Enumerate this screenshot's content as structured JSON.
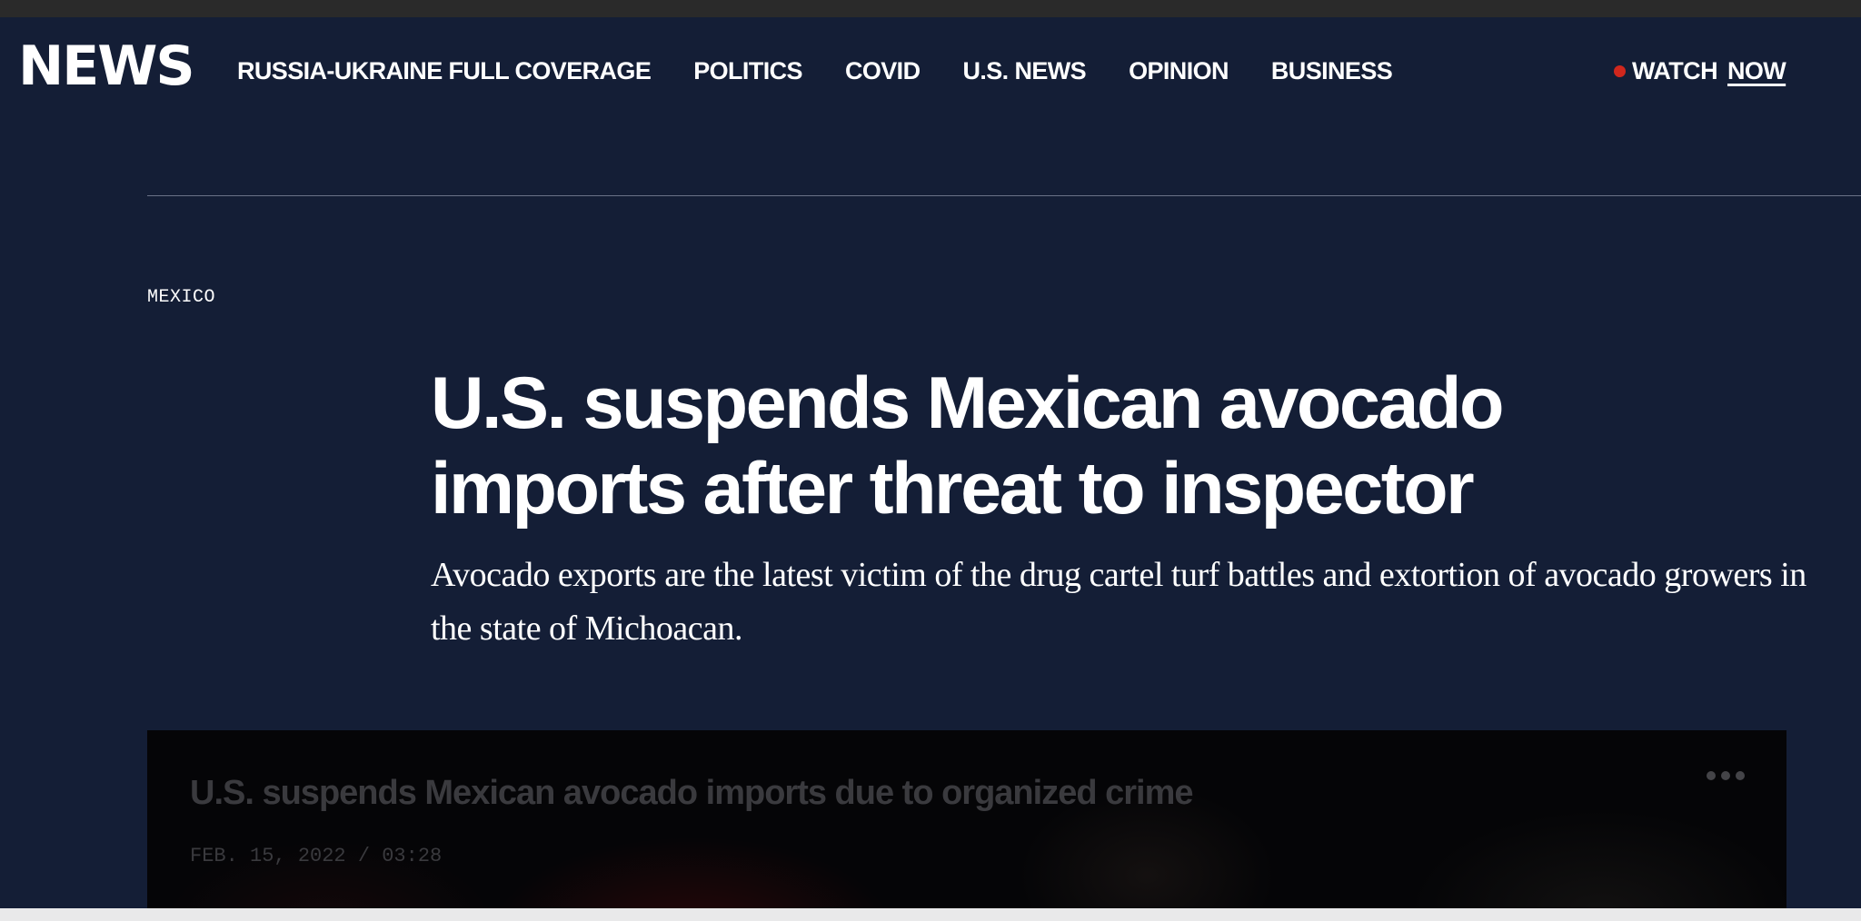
{
  "header": {
    "logo": "NEWS",
    "nav": [
      {
        "label": "RUSSIA-UKRAINE FULL COVERAGE"
      },
      {
        "label": "POLITICS"
      },
      {
        "label": "COVID"
      },
      {
        "label": "U.S. NEWS"
      },
      {
        "label": "OPINION"
      },
      {
        "label": "BUSINESS"
      }
    ],
    "watch": {
      "label": "WATCH",
      "emphasis": "NOW",
      "indicator_color": "#d0271d"
    }
  },
  "article": {
    "eyebrow": "MEXICO",
    "headline": "U.S. suspends Mexican avocado imports after threat to inspector",
    "dek": "Avocado exports are the latest victim of the drug cartel turf battles and extortion of avocado growers in the state of Michoacan."
  },
  "video": {
    "title": "U.S. suspends Mexican avocado imports due to organized crime",
    "meta": "FEB. 15, 2022 / 03:28",
    "more_icon": "more-horizontal-icon"
  },
  "colors": {
    "background": "#141e36",
    "accent_live": "#d0271d"
  }
}
